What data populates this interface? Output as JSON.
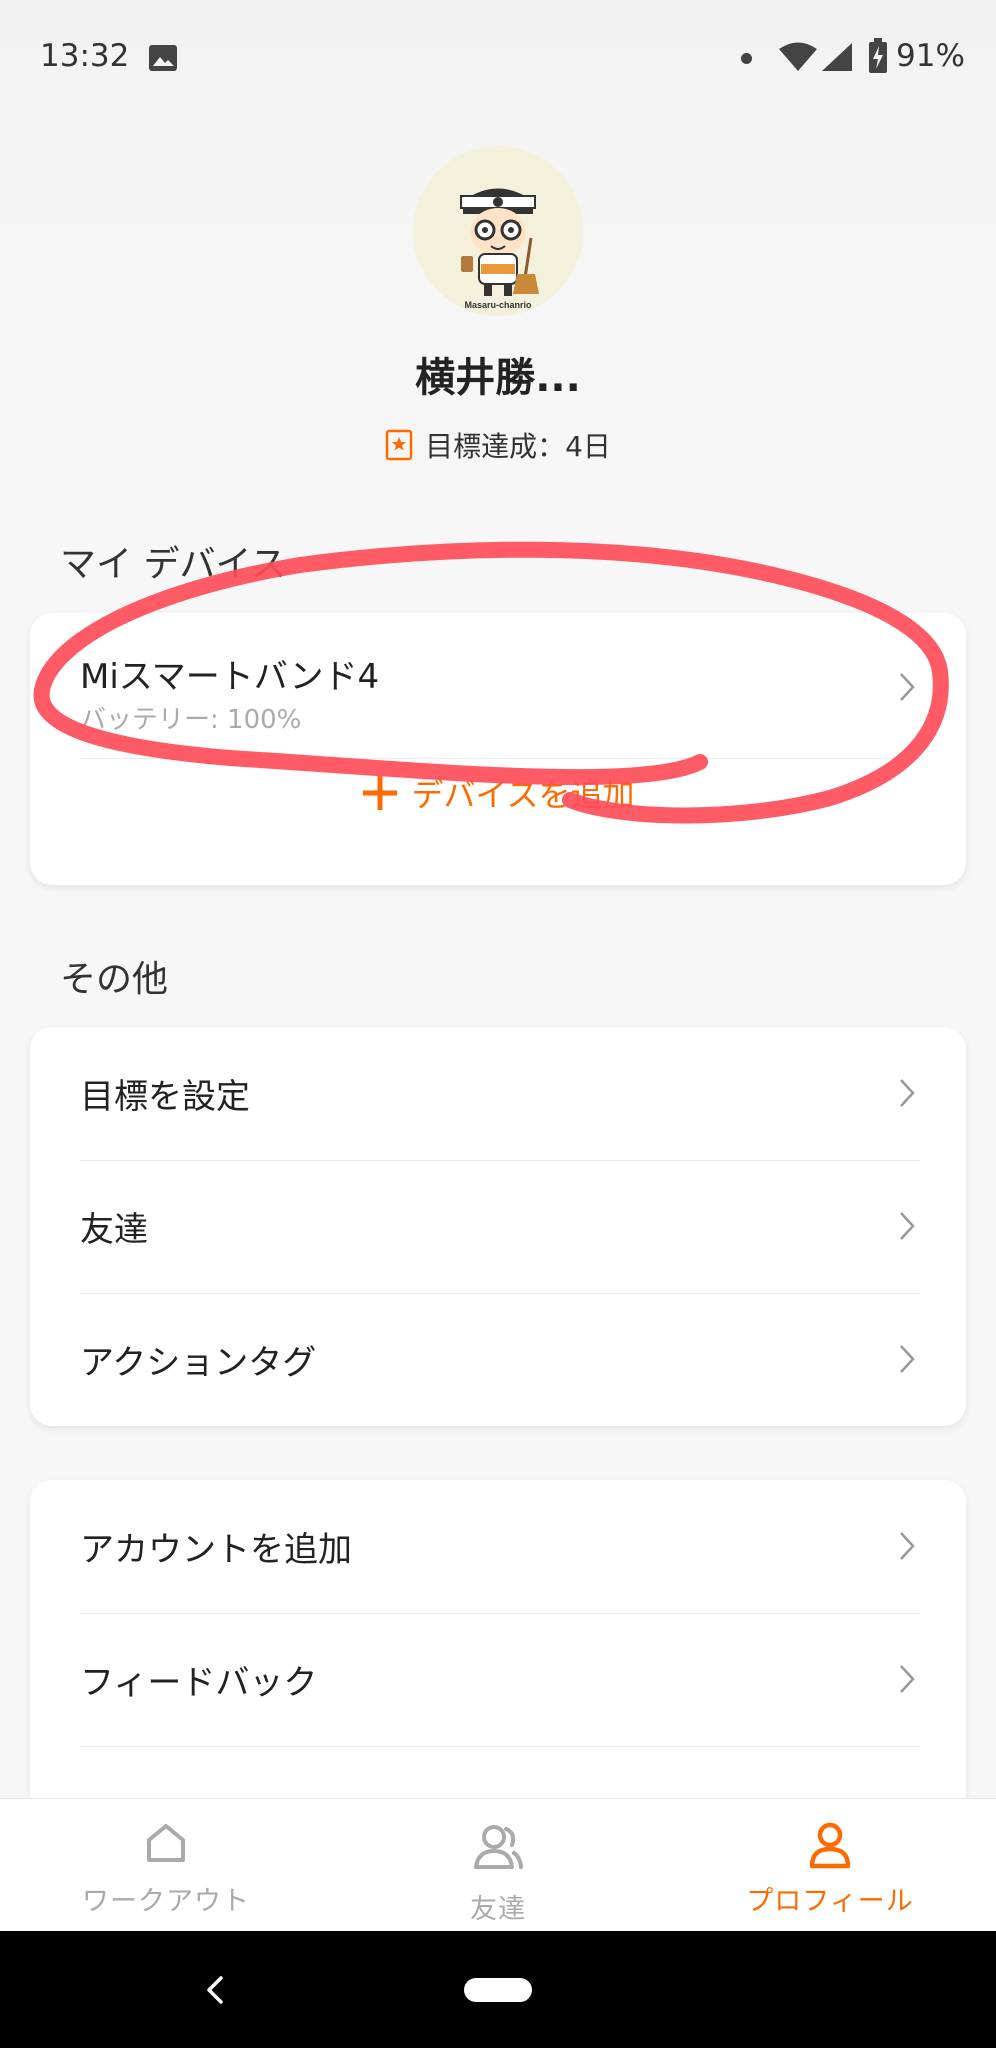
{
  "status_bar": {
    "time": "13:32",
    "battery": "91%"
  },
  "profile": {
    "name": "横井勝...",
    "goal_text": "目標達成：4日",
    "avatar_caption": "Masaru-chanrio"
  },
  "devices": {
    "section_title": "マイ デバイス",
    "device_name": "Miスマートバンド4",
    "battery": "バッテリー: 100%",
    "add_label": "デバイスを追加"
  },
  "others": {
    "section_title": "その他",
    "items": [
      {
        "label": "目標を設定"
      },
      {
        "label": "友達"
      },
      {
        "label": "アクションタグ"
      }
    ]
  },
  "account": {
    "items": [
      {
        "label": "アカウントを追加"
      },
      {
        "label": "フィードバック"
      }
    ]
  },
  "bottom_nav": {
    "items": [
      {
        "label": "ワークアウト",
        "icon": "home-icon"
      },
      {
        "label": "友達",
        "icon": "friends-icon"
      },
      {
        "label": "プロフィール",
        "icon": "profile-icon"
      }
    ],
    "active_color": "#ff6a00"
  },
  "colors": {
    "accent": "#ff6a00",
    "annotation": "#ff4d5a"
  }
}
